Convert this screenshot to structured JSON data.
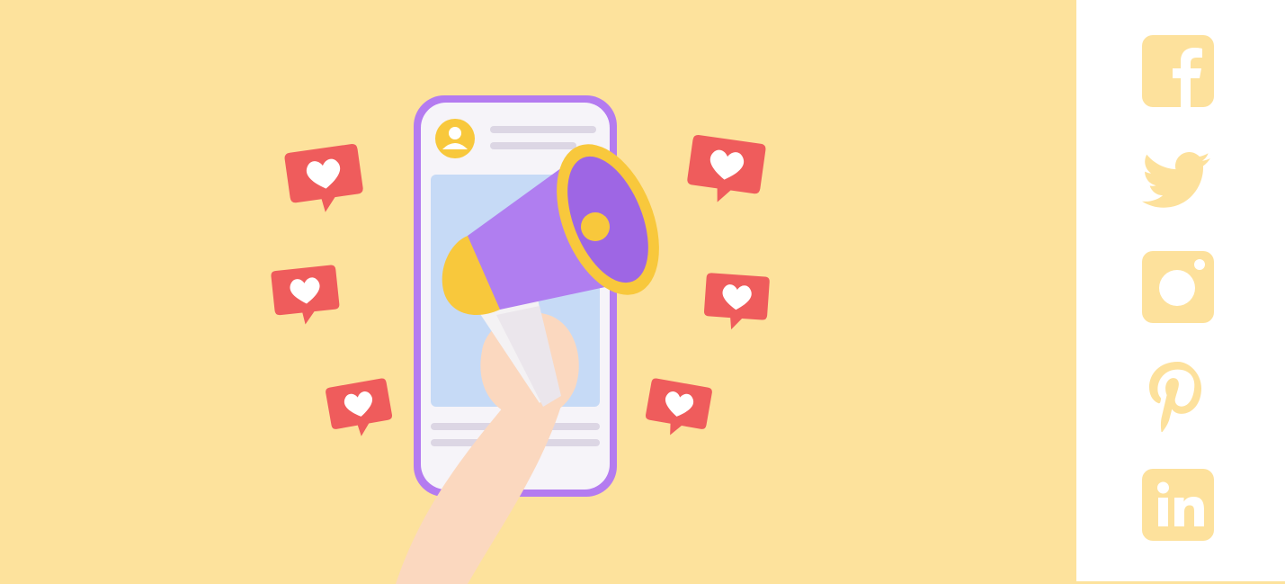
{
  "colors": {
    "background": "#fde29c",
    "social_icon": "#fde19c",
    "sidebar": "#ffffff",
    "phone_frame": "#b47bf0",
    "phone_screen": "#f6f4f9",
    "post_image": "#c6daf6",
    "megaphone_cone": "#b07ef0",
    "megaphone_rim": "#f8c83c",
    "heart_badge": "#ef5c5c",
    "skin": "#fbd8bf"
  },
  "hero": {
    "heart_badge_icon": "heart-icon",
    "profile_icon": "user-icon"
  },
  "social": {
    "links": [
      {
        "icon": "facebook-icon"
      },
      {
        "icon": "twitter-icon"
      },
      {
        "icon": "instagram-icon"
      },
      {
        "icon": "pinterest-icon"
      },
      {
        "icon": "linkedin-icon"
      }
    ]
  }
}
